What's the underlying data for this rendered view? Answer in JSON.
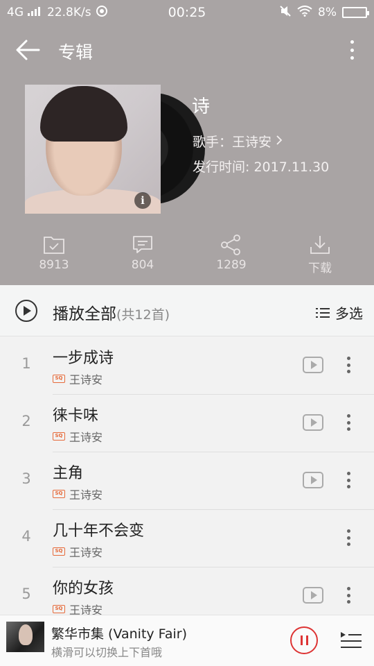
{
  "status_bar": {
    "network": "4G",
    "speed": "22.8K/s",
    "time": "00:25",
    "battery": "8%"
  },
  "topbar": {
    "title": "专辑"
  },
  "album": {
    "name": "诗",
    "singer": "歌手：王诗安",
    "release": "发行时间: 2017.11.30"
  },
  "actions": [
    {
      "icon": "folder-check-icon",
      "label": "8913"
    },
    {
      "icon": "comment-icon",
      "label": "804"
    },
    {
      "icon": "share-icon",
      "label": "1289"
    },
    {
      "icon": "download-icon",
      "label": "下载"
    }
  ],
  "playall": {
    "label": "播放全部",
    "count": "(共12首)",
    "multi": "多选"
  },
  "songs": [
    {
      "num": "1",
      "name": "一步成诗",
      "artist": "王诗安",
      "mv": true
    },
    {
      "num": "2",
      "name": "徕卡味",
      "artist": "王诗安",
      "mv": true
    },
    {
      "num": "3",
      "name": "主角",
      "artist": "王诗安",
      "mv": true
    },
    {
      "num": "4",
      "name": "几十年不会变",
      "artist": "王诗安",
      "mv": false
    },
    {
      "num": "5",
      "name": "你的女孩",
      "artist": "王诗安",
      "mv": true
    }
  ],
  "player": {
    "title": "繁华市集 (Vanity Fair)",
    "hint": "横滑可以切换上下首哦"
  },
  "colors": {
    "hero_bg": "#a9a4a4",
    "accent_red": "#d33333",
    "sq_badge": "#e66a3a"
  }
}
